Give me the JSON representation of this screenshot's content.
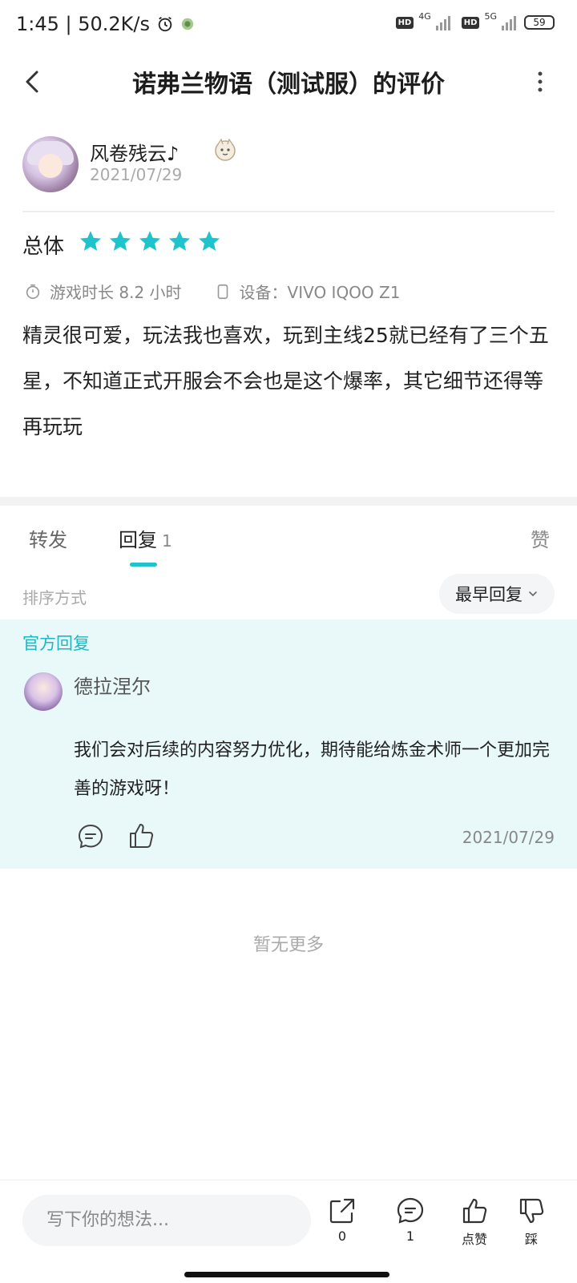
{
  "status_bar": {
    "time_speed": "1:45 | 50.2K/s",
    "hd1": "HD",
    "net1": "4G",
    "hd2": "HD",
    "net2": "5G",
    "battery": "59",
    "alarm_icon": "alarm-clock-icon",
    "app_icon": "app-notification-icon"
  },
  "nav": {
    "title": "诺弗兰物语（测试服）的评价",
    "back_icon": "chevron-left-icon",
    "more_icon": "more-vertical-icon"
  },
  "author": {
    "name": "风卷残云♪",
    "date": "2021/07/29",
    "badge_icon": "character-badge-icon"
  },
  "review": {
    "overall_label": "总体",
    "rating": 5,
    "rating_max": 5,
    "playtime_label": "游戏时长 8.2 小时",
    "device_label": "设备：VIVO IQOO Z1",
    "text": "精灵很可爱，玩法我也喜欢，玩到主线25就已经有了三个五星，不知道正式开服会不会也是这个爆率，其它细节还得等再玩玩",
    "accent_color": "#1ec3cc"
  },
  "tabs": {
    "repost": "转发",
    "reply": "回复",
    "reply_count": "1",
    "like": "赞"
  },
  "sort": {
    "label": "排序方式",
    "selected": "最早回复"
  },
  "official_reply": {
    "section_label": "官方回复",
    "name": "德拉涅尔",
    "text": "我们会对后续的内容努力优化，期待能给炼金术师一个更加完善的游戏呀！",
    "date": "2021/07/29",
    "background_color": "#e9f8f9"
  },
  "no_more": "暂无更多",
  "bottom_bar": {
    "input_placeholder": "写下你的想法...",
    "share_count": "0",
    "reply_count": "1",
    "like_label": "点赞",
    "dislike_label": "踩"
  }
}
